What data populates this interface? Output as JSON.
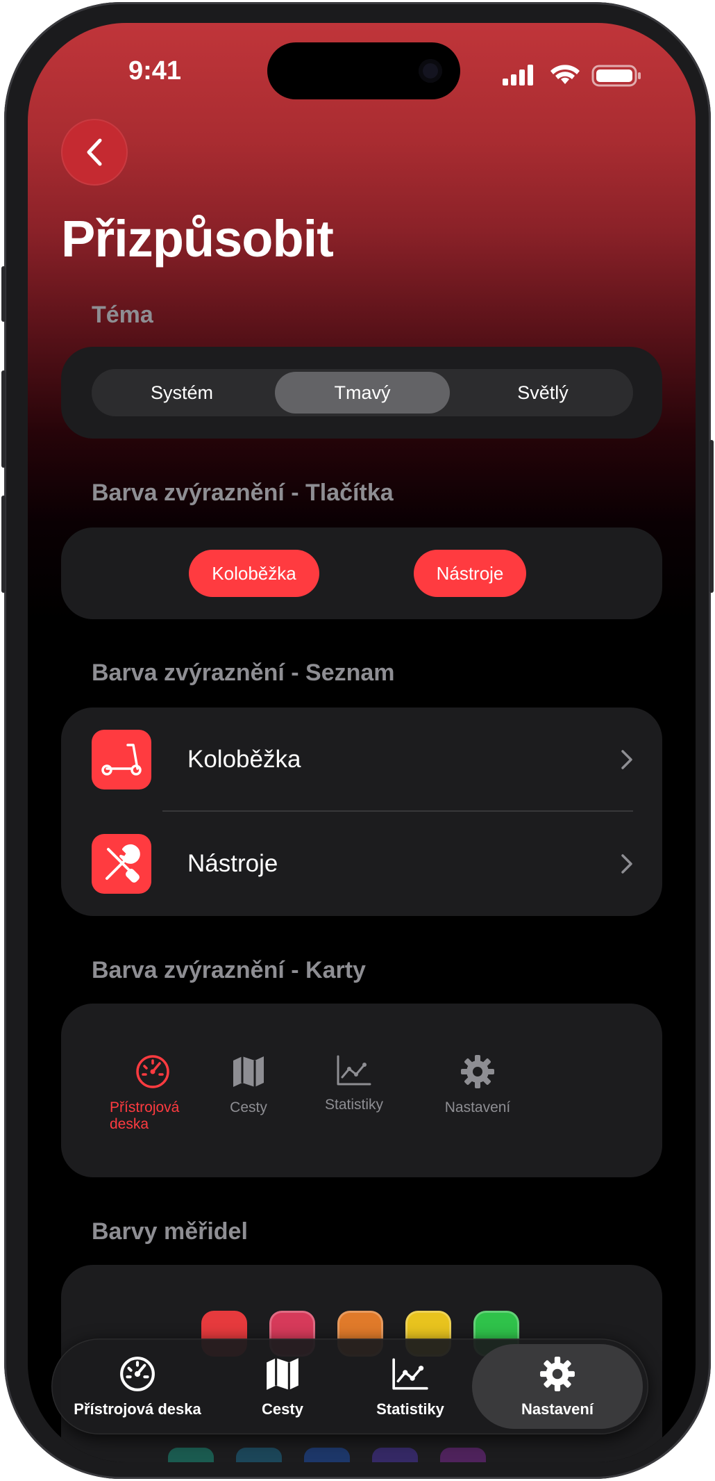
{
  "status_bar": {
    "time": "9:41"
  },
  "header": {
    "title": "Přizpůsobit",
    "back_icon": "chevron-left-icon"
  },
  "theme": {
    "label": "Téma",
    "options": [
      "Systém",
      "Tmavý",
      "Světlý"
    ],
    "selected": "Tmavý"
  },
  "accent_buttons": {
    "label": "Barva zvýraznění - Tlačítka",
    "buttons": [
      "Koloběžka",
      "Nástroje"
    ]
  },
  "accent_list": {
    "label": "Barva zvýraznění - Seznam",
    "items": [
      {
        "label": "Koloběžka",
        "icon": "scooter-icon"
      },
      {
        "label": "Nástroje",
        "icon": "tools-icon"
      }
    ]
  },
  "accent_cards": {
    "label": "Barva zvýraznění - Karty",
    "tabs": [
      {
        "label": "Přístrojová deska",
        "icon": "speedometer-icon",
        "active": true
      },
      {
        "label": "Cesty",
        "icon": "map-icon",
        "active": false
      },
      {
        "label": "Statistiky",
        "icon": "chart-icon",
        "active": false
      },
      {
        "label": "Nastavení",
        "icon": "gear-icon",
        "active": false
      }
    ]
  },
  "gauge_colors": {
    "label": "Barvy měřidel",
    "swatches": [
      "#e63a3d",
      "#d63a5a",
      "#e07a2a",
      "#e8c31e",
      "#2fc24a"
    ],
    "bottom_swatches": [
      "#1c8f7a",
      "#1d6a8a",
      "#1f4fa8",
      "#4a35a0",
      "#7a2a90"
    ]
  },
  "colors": {
    "accent": "#ff3b40",
    "card": "#1c1c1e",
    "secondary_text": "#8e8e93"
  },
  "tab_bar": {
    "items": [
      {
        "label": "Přístrojová deska",
        "icon": "speedometer-icon"
      },
      {
        "label": "Cesty",
        "icon": "map-icon"
      },
      {
        "label": "Statistiky",
        "icon": "chart-icon"
      },
      {
        "label": "Nastavení",
        "icon": "gear-icon"
      }
    ],
    "selected": "Nastavení"
  }
}
